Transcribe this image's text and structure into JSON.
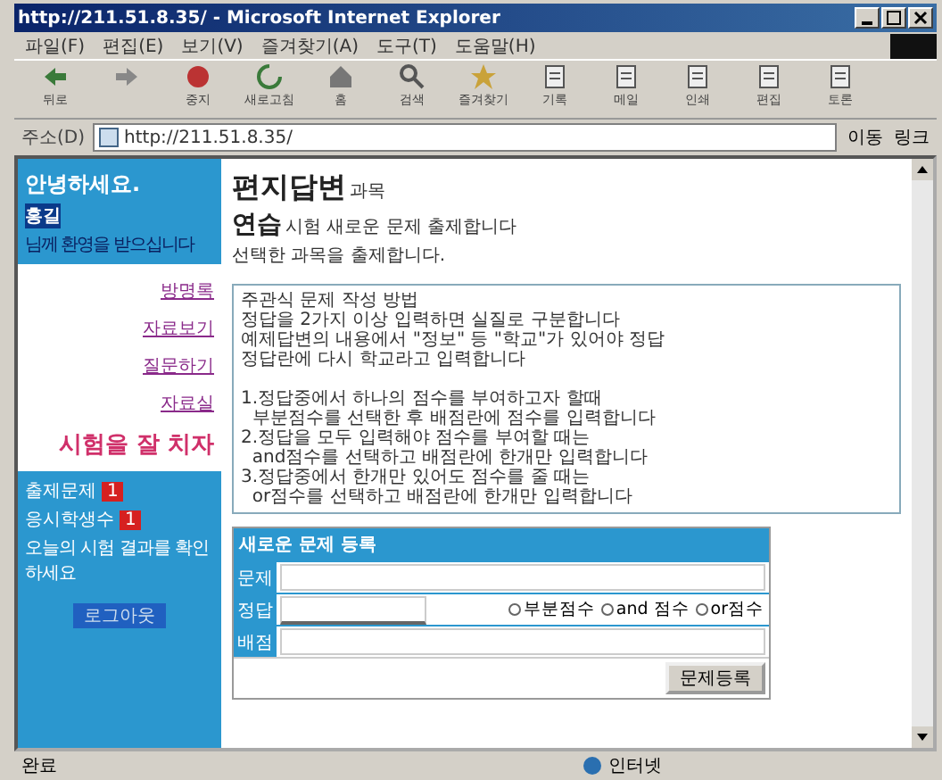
{
  "window": {
    "title": "http://211.51.8.35/ - Microsoft Internet Explorer"
  },
  "menu": [
    "파일(F)",
    "편집(E)",
    "보기(V)",
    "즐겨찾기(A)",
    "도구(T)",
    "도움말(H)"
  ],
  "toolbar": [
    {
      "kind": "back",
      "label": "뒤로"
    },
    {
      "kind": "forward"
    },
    {
      "kind": "stop",
      "label": "중지"
    },
    {
      "kind": "refresh",
      "label": "새로고침"
    },
    {
      "kind": "home",
      "label": "홈"
    },
    {
      "kind": "search",
      "label": "검색"
    },
    {
      "kind": "favorites",
      "label": "즐겨찾기"
    },
    {
      "kind": "history",
      "label": "기록"
    },
    {
      "kind": "mail",
      "label": "메일"
    },
    {
      "kind": "print",
      "label": "인쇄"
    },
    {
      "kind": "edit",
      "label": "편집"
    },
    {
      "kind": "discuss",
      "label": "토론"
    }
  ],
  "address": {
    "label": "주소(D)",
    "value": "http://211.51.8.35/",
    "go": "이동",
    "links": "링크"
  },
  "sidebar": {
    "greeting": "안녕하세요.",
    "user": "홍길",
    "welcome": "님께 환영을 받으십니다",
    "links": [
      "방명록",
      "자료보기",
      "질문하기",
      "자료실"
    ],
    "slogan": "시험을 잘 치자",
    "stats": [
      {
        "label": "출제문제",
        "badge": "1"
      },
      {
        "label": "응시학생수",
        "badge": "1"
      }
    ],
    "note": "오늘의 시험 결과를 확인 하세요",
    "logout": "로그아웃"
  },
  "main": {
    "title": "편지답변",
    "title_suffix": "과목",
    "subtitle": "연습",
    "subtitle_suffix": "시험 새로운 문제 출제합니다",
    "desc": "선택한 과목을 출제합니다.",
    "help": [
      "주관식 문제 작성 방법",
      "정답을 2가지 이상 입력하면 실질로 구분합니다",
      "예제답변의 내용에서 \"정보\" 등 \"학교\"가 있어야 정답",
      "정답란에 다시 학교라고 입력합니다"
    ],
    "steps": [
      "1.정답중에서 하나의 점수를 부여하고자 할때",
      "  부분점수를 선택한 후 배점란에 점수를 입력합니다",
      "2.정답을 모두 입력해야 점수를 부여할 때는",
      "  and점수를 선택하고 배점란에 한개만 입력합니다",
      "3.정답중에서 한개만 있어도 점수를 줄 때는",
      "  or점수를 선택하고 배점란에 한개만 입력합니다"
    ],
    "form": {
      "header": "새로운 문제 등록",
      "question_label": "문제",
      "answer_label": "정답",
      "score_label": "배점",
      "options": [
        {
          "label": "부분점수",
          "selected": false
        },
        {
          "label": "and 점수",
          "selected": false
        },
        {
          "label": "or점수",
          "selected": false
        }
      ],
      "submit": "문제등록"
    }
  },
  "status": {
    "left": "완료",
    "zone": "인터넷"
  }
}
